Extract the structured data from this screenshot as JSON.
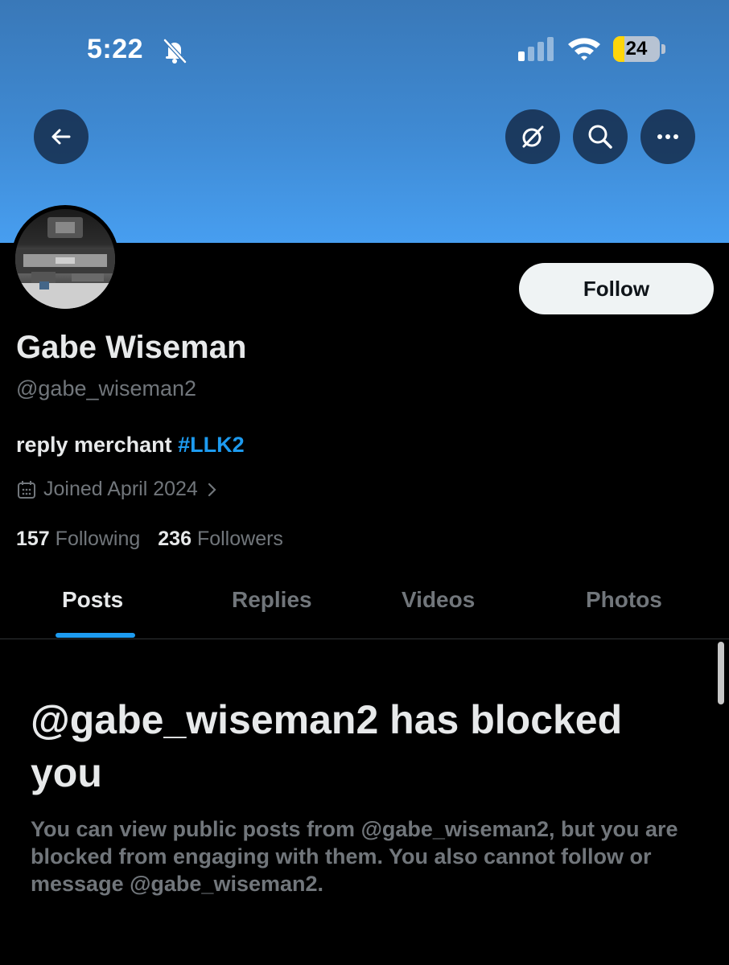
{
  "status_bar": {
    "time": "5:22",
    "battery": "24",
    "battery_level_percent": 24,
    "icons": [
      "bell-off-icon",
      "signal-icon",
      "wifi-icon",
      "battery-icon"
    ]
  },
  "header": {
    "buttons": [
      "arrow-left-icon",
      "grok-icon",
      "search-icon",
      "more-icon"
    ]
  },
  "profile": {
    "display_name": "Gabe Wiseman",
    "handle": "@gabe_wiseman2",
    "bio_text": "reply merchant ",
    "bio_hashtag": "#LLK2",
    "joined": "Joined April 2024",
    "following_count": "157",
    "following_label": "Following",
    "followers_count": "236",
    "followers_label": "Followers",
    "follow_button": "Follow"
  },
  "tabs": [
    {
      "label": "Posts",
      "active": true
    },
    {
      "label": "Replies",
      "active": false
    },
    {
      "label": "Videos",
      "active": false
    },
    {
      "label": "Photos",
      "active": false
    }
  ],
  "blocked": {
    "title": "@gabe_wiseman2 has blocked you",
    "description": "You can view public posts from @gabe_wiseman2, but you are blocked from engaging with them. You also cannot follow or message @gabe_wiseman2."
  },
  "colors": {
    "accent": "#1d9bf0",
    "muted": "#71767b",
    "background": "#000000",
    "banner": "#479ef0"
  }
}
